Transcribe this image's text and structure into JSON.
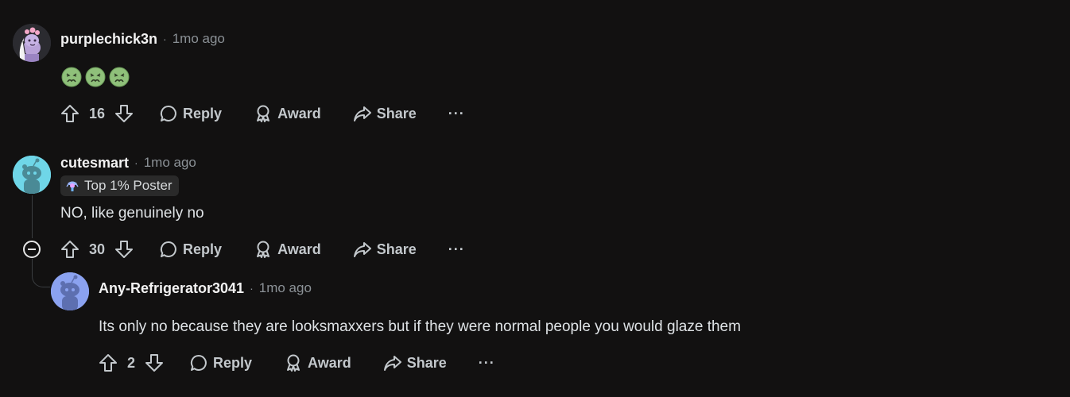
{
  "comments": [
    {
      "username": "purplechick3n",
      "time": "1mo ago",
      "body_emoji": [
        "nauseated-face",
        "nauseated-face",
        "nauseated-face"
      ],
      "score": "16",
      "reply_label": "Reply",
      "award_label": "Award",
      "share_label": "Share",
      "more_label": "···"
    },
    {
      "username": "cutesmart",
      "time": "1mo ago",
      "flair": "Top 1% Poster",
      "body": "NO, like genuinely no",
      "score": "30",
      "reply_label": "Reply",
      "award_label": "Award",
      "share_label": "Share",
      "more_label": "···"
    },
    {
      "username": "Any-Refrigerator3041",
      "time": "1mo ago",
      "body": "Its only no because they are looksmaxxers but if they were normal people you would glaze them",
      "score": "2",
      "reply_label": "Reply",
      "award_label": "Award",
      "share_label": "Share",
      "more_label": "···"
    }
  ],
  "separator": "·",
  "colors": {
    "background": "#121111",
    "muted_text": "#8b9196",
    "action_text": "#c3c8cc",
    "avatar_purple": "#2b2b30",
    "avatar_cyan": "#6fd6e8",
    "avatar_blue": "#8ba2f0"
  }
}
